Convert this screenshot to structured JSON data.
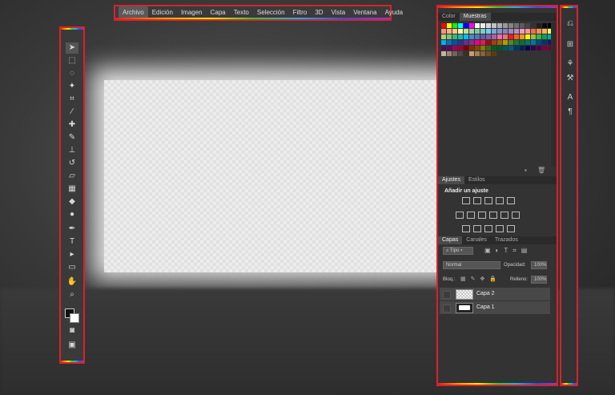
{
  "menu": {
    "items": [
      "Archivo",
      "Edición",
      "Imagen",
      "Capa",
      "Texto",
      "Selección",
      "Filtro",
      "3D",
      "Vista",
      "Ventana",
      "Ayuda"
    ],
    "active": "Archivo"
  },
  "tools": [
    {
      "name": "move-tool-icon",
      "glyph": "➤"
    },
    {
      "name": "marquee-tool-icon",
      "glyph": "⬚"
    },
    {
      "name": "lasso-tool-icon",
      "glyph": "◌"
    },
    {
      "name": "magic-wand-tool-icon",
      "glyph": "✦"
    },
    {
      "name": "crop-tool-icon",
      "glyph": "⌗"
    },
    {
      "name": "eyedropper-tool-icon",
      "glyph": "⁄"
    },
    {
      "name": "healing-brush-tool-icon",
      "glyph": "✚"
    },
    {
      "name": "brush-tool-icon",
      "glyph": "✎"
    },
    {
      "name": "clone-stamp-tool-icon",
      "glyph": "⊥"
    },
    {
      "name": "history-brush-tool-icon",
      "glyph": "↺"
    },
    {
      "name": "eraser-tool-icon",
      "glyph": "▱"
    },
    {
      "name": "gradient-tool-icon",
      "glyph": "▦"
    },
    {
      "name": "blur-tool-icon",
      "glyph": "◆"
    },
    {
      "name": "dodge-tool-icon",
      "glyph": "●"
    },
    {
      "name": "pen-tool-icon",
      "glyph": "✒"
    },
    {
      "name": "type-tool-icon",
      "glyph": "T"
    },
    {
      "name": "path-selection-tool-icon",
      "glyph": "▸"
    },
    {
      "name": "shape-tool-icon",
      "glyph": "▭"
    },
    {
      "name": "hand-tool-icon",
      "glyph": "✋"
    },
    {
      "name": "zoom-tool-icon",
      "glyph": "⌕"
    }
  ],
  "swatch_panel": {
    "tabs": [
      "Color",
      "Muestras"
    ],
    "active_tab": "Muestras",
    "colors": [
      "#ff0000",
      "#ffff00",
      "#00ff00",
      "#00ffff",
      "#0000ff",
      "#ff00ff",
      "#ffffff",
      "#ebebeb",
      "#d6d6d6",
      "#c2c2c2",
      "#adadad",
      "#999999",
      "#858585",
      "#707070",
      "#5c5c5c",
      "#474747",
      "#333333",
      "#1f1f1f",
      "#0a0a0a",
      "#000000",
      "#f7977a",
      "#f9ad81",
      "#fdc68a",
      "#fff79a",
      "#c4df9b",
      "#a3d39c",
      "#82ca9d",
      "#7bcdc8",
      "#6ecff6",
      "#7ea7d8",
      "#8493ca",
      "#8882be",
      "#a187be",
      "#bc8dbf",
      "#f49ac2",
      "#f6989d",
      "#f26c4f",
      "#f68e55",
      "#fbaf5c",
      "#fff467",
      "#acd372",
      "#7cc576",
      "#3bb878",
      "#1abbb4",
      "#00bff3",
      "#438ccb",
      "#5574b9",
      "#605ca8",
      "#855fa8",
      "#a763a8",
      "#f06ea9",
      "#f26d7d",
      "#ed1c24",
      "#f26522",
      "#f7941d",
      "#fff200",
      "#8dc73f",
      "#39b54a",
      "#00a651",
      "#00a99d",
      "#00aeef",
      "#0072bc",
      "#0054a6",
      "#2e3192",
      "#662d91",
      "#92278f",
      "#ec008c",
      "#ed145b",
      "#9e0b0f",
      "#a0410d",
      "#a36209",
      "#aba000",
      "#598527",
      "#197b30",
      "#007236",
      "#00746b",
      "#0076a3",
      "#004a80",
      "#003471",
      "#1b1464",
      "#440e62",
      "#630460",
      "#9e005d",
      "#9e0039",
      "#790000",
      "#7b2e00",
      "#7d4900",
      "#827b00",
      "#406618",
      "#005e20",
      "#005826",
      "#005952",
      "#005b7f",
      "#003663",
      "#002157",
      "#0d004c",
      "#32004b",
      "#4b0049",
      "#7b0046",
      "#7a0026",
      "#c7b299",
      "#998675",
      "#736357",
      "#534741",
      "#37302d",
      "#c69c6d",
      "#a67c52",
      "#8c6239",
      "#754c24",
      "#603913"
    ]
  },
  "adjust_panel": {
    "tabs": [
      "Ajustes",
      "Estilos"
    ],
    "active_tab": "Ajustes",
    "title": "Añadir un ajuste"
  },
  "layers_panel": {
    "tabs": [
      "Capas",
      "Canales",
      "Trazados"
    ],
    "active_tab": "Capas",
    "filter_label": "Tipo",
    "blend_mode": "Normal",
    "opacity_label": "Opacidad:",
    "opacity_value": "100%",
    "lock_label": "Bloq.:",
    "fill_label": "Relleno:",
    "fill_value": "100%",
    "layers": [
      {
        "name": "Capa 2",
        "thumb": "transparent"
      },
      {
        "name": "Capa 1",
        "thumb": "white"
      }
    ]
  },
  "strip_icons": [
    "history-icon",
    "properties-icon",
    "brush-presets-icon",
    "tool-presets-icon",
    "character-icon",
    "paragraph-icon"
  ]
}
